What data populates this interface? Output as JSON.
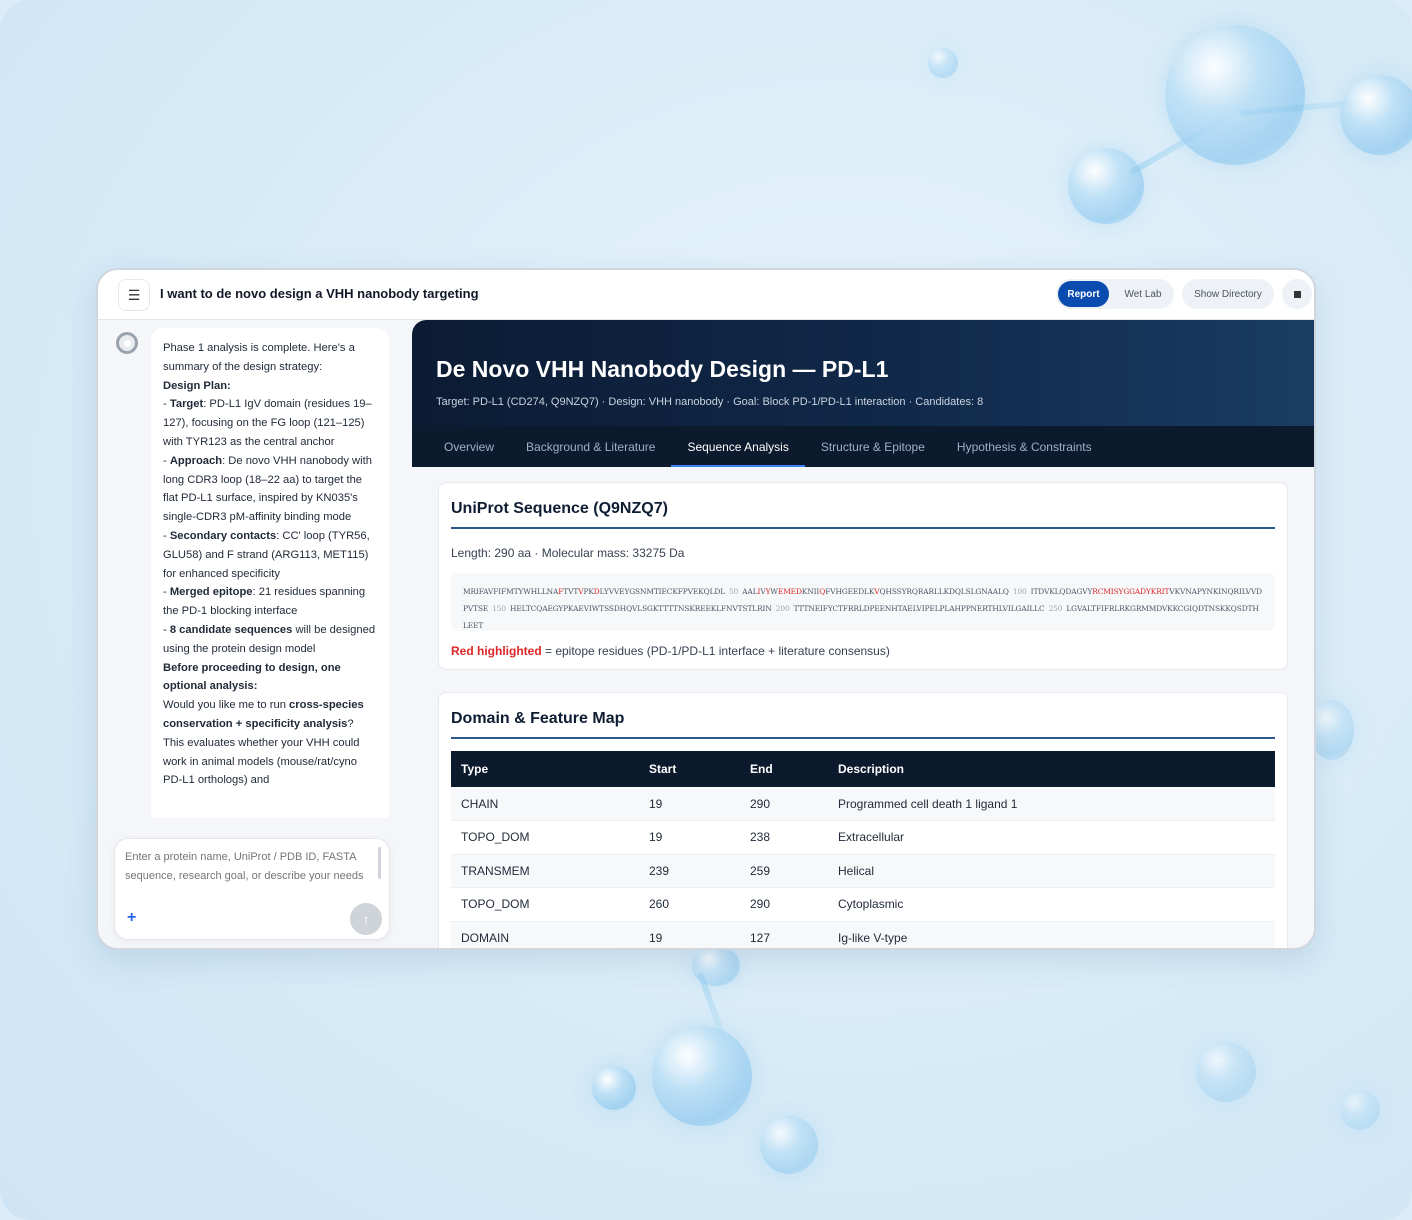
{
  "topbar": {
    "menu_icon": "hamburger-icon",
    "chat_title": "I want to de novo design a VHH nanobody targeting",
    "report_label": "Report",
    "wetlab_label": "Wet Lab",
    "directory_label": "Show Directory",
    "stop_icon": "stop-icon"
  },
  "chat": {
    "intro": "Phase 1 analysis is complete. Here's a summary of the design strategy:",
    "plan_heading": "Design Plan:",
    "target_label": "Target",
    "target_text": ": PD-L1 IgV domain (residues 19–127), focusing on the FG loop (121–125) with TYR123 as the central anchor",
    "approach_label": "Approach",
    "approach_text": ": De novo VHH nanobody with long CDR3 loop (18–22 aa) to target the flat PD-L1 surface, inspired by KN035's single-CDR3 pM-affinity binding mode",
    "secondary_label": "Secondary contacts",
    "secondary_text": ": CC' loop (TYR56, GLU58) and F strand (ARG113, MET115) for enhanced specificity",
    "epitope_label": "Merged epitope",
    "epitope_text": ": 21 residues spanning the PD-1 blocking interface",
    "candidates_label": "8 candidate sequences",
    "candidates_text": " will be designed using the protein design model",
    "before_heading": "Before proceeding to design, one optional analysis:",
    "question_a": "Would you like me to run ",
    "question_bold": "cross-species conservation + specificity analysis",
    "question_b": "? This evaluates whether your VHH could work in animal models (mouse/rat/cyno PD-L1 orthologs) and"
  },
  "composer": {
    "placeholder": "Enter a protein name, UniProt / PDB ID, FASTA sequence, research goal, or describe your needs",
    "plus_label": "+",
    "send_icon": "arrow-up-icon"
  },
  "report": {
    "title": "De Novo VHH Nanobody Design — PD-L1",
    "subtitle": "Target: PD-L1 (CD274, Q9NZQ7) · Design: VHH nanobody · Goal: Block PD-1/PD-L1 interaction · Candidates: 8",
    "tabs": [
      {
        "label": "Overview",
        "active": false
      },
      {
        "label": "Background & Literature",
        "active": false
      },
      {
        "label": "Sequence Analysis",
        "active": true
      },
      {
        "label": "Structure & Epitope",
        "active": false
      },
      {
        "label": "Hypothesis & Constraints",
        "active": false
      }
    ]
  },
  "sequence_card": {
    "title": "UniProt Sequence (Q9NZQ7)",
    "meta": "Length: 290 aa · Molecular mass: 33275 Da",
    "segments": [
      {
        "t": "MRIFAVFIFMTYWHLLNA",
        "c": "n"
      },
      {
        "t": "F",
        "c": "ep"
      },
      {
        "t": "TVT",
        "c": "n"
      },
      {
        "t": "V",
        "c": "ep"
      },
      {
        "t": "PK",
        "c": "n"
      },
      {
        "t": "D",
        "c": "ep"
      },
      {
        "t": "LYVVEYGSNMTIECKFPVEKQLDL",
        "c": "n"
      },
      {
        "t": "50",
        "c": "num"
      },
      {
        "t": "AAL",
        "c": "n"
      },
      {
        "t": "I",
        "c": "ep"
      },
      {
        "t": "V",
        "c": "n"
      },
      {
        "t": "Y",
        "c": "ep"
      },
      {
        "t": "W",
        "c": "n"
      },
      {
        "t": "EMED",
        "c": "ep"
      },
      {
        "t": "KNII",
        "c": "n"
      },
      {
        "t": "Q",
        "c": "ep"
      },
      {
        "t": "FVHGEEDLK",
        "c": "n"
      },
      {
        "t": "V",
        "c": "ep"
      },
      {
        "t": "QHSSYRQRARLLKDQLSLGNAALQ",
        "c": "n"
      },
      {
        "t": "100",
        "c": "num"
      },
      {
        "t": "ITDVKLQDAGVY",
        "c": "n"
      },
      {
        "t": "RCMISYGGADYKRIT",
        "c": "ep"
      },
      {
        "t": "VKVNAPYNKINQRILVVDPVTSE",
        "c": "n"
      },
      {
        "t": "150",
        "c": "num"
      },
      {
        "t": "HELTCQAEGYPKAEVIWTSSDHQVLSGKTTTTNSKREEKLFNVTSTLRIN",
        "c": "n"
      },
      {
        "t": "200",
        "c": "num"
      },
      {
        "t": "TTTNEIFYCTFRRLDPEENHTAELVIPELPLAHPPNERTHLVILGAILLC",
        "c": "n"
      },
      {
        "t": "250",
        "c": "num"
      },
      {
        "t": "LGVALTFIFRLRKGRMMDVKKCGIQDTNSKKQSDTHLEET",
        "c": "n"
      }
    ],
    "legend_red": "Red highlighted",
    "legend_rest": " = epitope residues (PD-1/PD-L1 interface + literature consensus)"
  },
  "domain_card": {
    "title": "Domain & Feature Map",
    "columns": [
      "Type",
      "Start",
      "End",
      "Description"
    ],
    "rows": [
      [
        "CHAIN",
        "19",
        "290",
        "Programmed cell death 1 ligand 1"
      ],
      [
        "TOPO_DOM",
        "19",
        "238",
        "Extracellular"
      ],
      [
        "TRANSMEM",
        "239",
        "259",
        "Helical"
      ],
      [
        "TOPO_DOM",
        "260",
        "290",
        "Cytoplasmic"
      ],
      [
        "DOMAIN",
        "19",
        "127",
        "Ig-like V-type"
      ]
    ]
  }
}
